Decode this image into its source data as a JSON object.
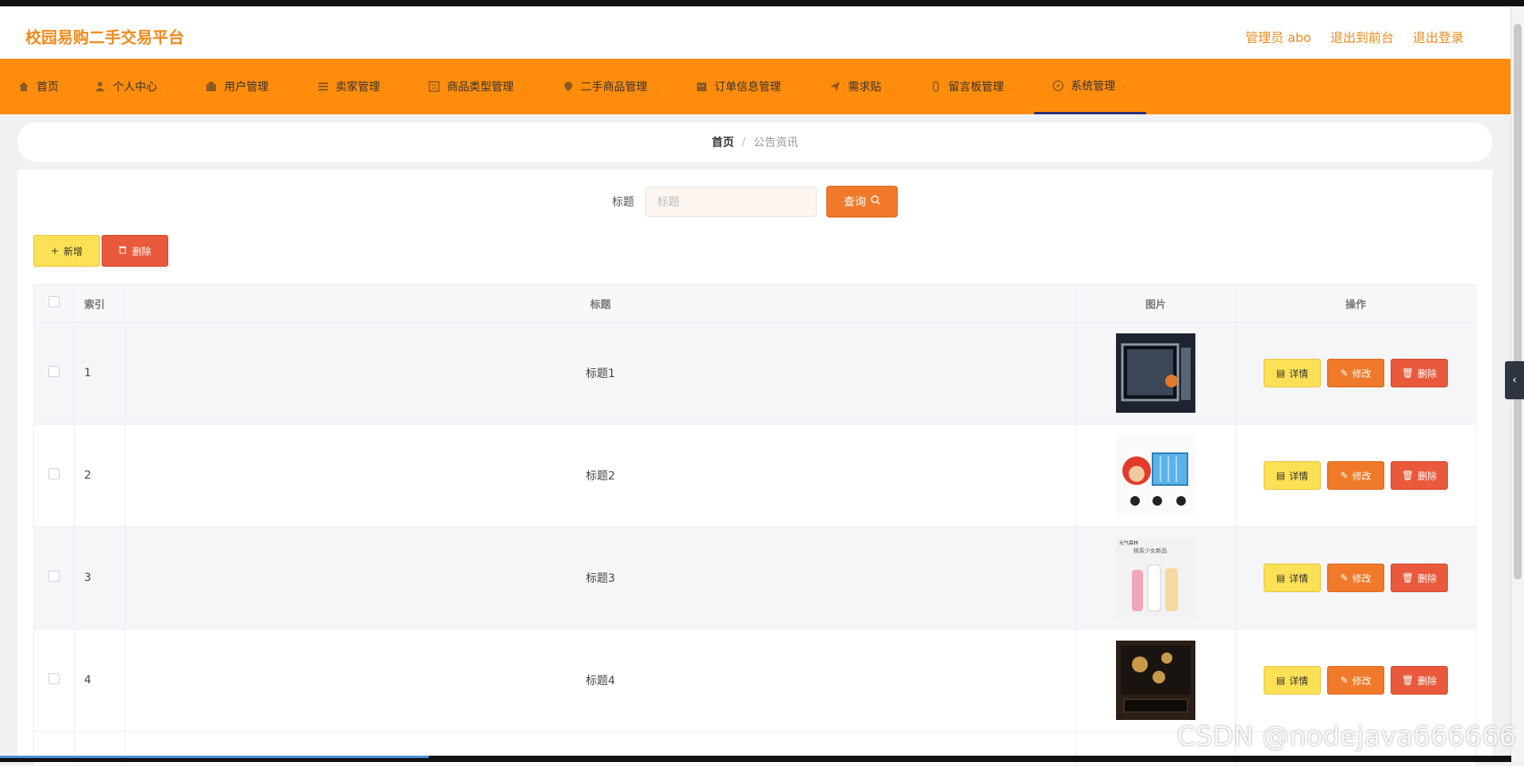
{
  "header": {
    "brand": "校园易购二手交易平台",
    "admin": "管理员 abo",
    "to_front": "退出到前台",
    "logout": "退出登录"
  },
  "nav": [
    {
      "label": "首页",
      "icon": "home-icon"
    },
    {
      "label": "个人中心",
      "icon": "user-icon"
    },
    {
      "label": "用户管理",
      "icon": "users-icon"
    },
    {
      "label": "卖家管理",
      "icon": "list-icon"
    },
    {
      "label": "商品类型管理",
      "icon": "category-icon"
    },
    {
      "label": "二手商品管理",
      "icon": "location-icon"
    },
    {
      "label": "订单信息管理",
      "icon": "calendar-icon"
    },
    {
      "label": "需求贴",
      "icon": "send-icon"
    },
    {
      "label": "留言板管理",
      "icon": "message-icon"
    },
    {
      "label": "系统管理",
      "icon": "compass-icon",
      "active": true
    }
  ],
  "breadcrumb": {
    "home": "首页",
    "current": "公告资讯"
  },
  "search": {
    "label": "标题",
    "placeholder": "标题",
    "query_label": "查询"
  },
  "actions": {
    "add_label": "新增",
    "delete_label": "删除"
  },
  "table": {
    "headers": {
      "index": "索引",
      "title": "标题",
      "image": "图片",
      "ops": "操作"
    },
    "rows": [
      {
        "index": "1",
        "title": "标题1",
        "image": "microwave-oven"
      },
      {
        "index": "2",
        "title": "标题2",
        "image": "shopping-cart-mascot"
      },
      {
        "index": "3",
        "title": "标题3",
        "image": "bottled-drinks"
      },
      {
        "index": "4",
        "title": "标题4",
        "image": "dark-gift-box"
      }
    ],
    "ops": {
      "detail": "详情",
      "edit": "修改",
      "delete": "删除"
    }
  },
  "image_text": {
    "drinks_header": "元气森林",
    "drinks_sub": "桃系少女新品"
  },
  "watermark": "CSDN @nodejava666666",
  "colors": {
    "brand": "#f08a1d",
    "nav_bg": "#ff8c0a",
    "primary_btn": "#f07a2a",
    "warning_btn": "#fce055",
    "danger_btn": "#e95a3c"
  }
}
